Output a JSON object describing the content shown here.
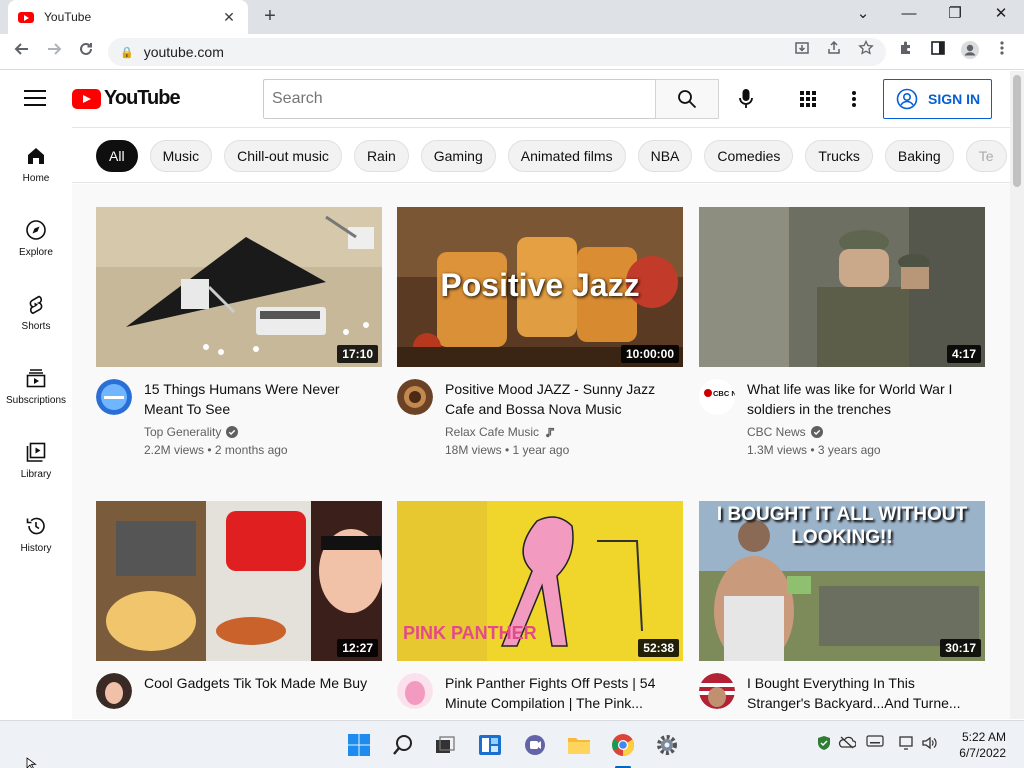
{
  "browser": {
    "tab_title": "YouTube",
    "tab_close": "✕",
    "new_tab": "+",
    "url": "youtube.com",
    "window_controls": [
      "⌄",
      "—",
      "❐",
      "✕"
    ]
  },
  "header": {
    "logo_text": "YouTube",
    "search_placeholder": "Search",
    "sign_in_label": "SIGN IN"
  },
  "sidebar": {
    "items": [
      {
        "label": "Home",
        "icon": "home-icon"
      },
      {
        "label": "Explore",
        "icon": "compass-icon"
      },
      {
        "label": "Shorts",
        "icon": "shorts-icon"
      },
      {
        "label": "Subscriptions",
        "icon": "subscriptions-icon"
      },
      {
        "label": "Library",
        "icon": "library-icon"
      },
      {
        "label": "History",
        "icon": "history-icon"
      }
    ]
  },
  "chips": [
    "All",
    "Music",
    "Chill-out music",
    "Rain",
    "Gaming",
    "Animated films",
    "NBA",
    "Comedies",
    "Trucks",
    "Baking",
    "Te"
  ],
  "videos": [
    {
      "title": "15 Things Humans Were Never Meant To See",
      "channel": "Top Generality",
      "verified": true,
      "stats": "2.2M views • 2 months ago",
      "duration": "17:10"
    },
    {
      "title": "Positive Mood JAZZ - Sunny Jazz Cafe and Bossa Nova Music",
      "channel": "Relax Cafe Music",
      "music_badge": true,
      "stats": "18M views • 1 year ago",
      "duration": "10:00:00",
      "overlay": "Positive Jazz"
    },
    {
      "title": "What life was like for World War I soldiers in the trenches",
      "channel": "CBC News",
      "verified": true,
      "stats": "1.3M views • 3 years ago",
      "duration": "4:17"
    },
    {
      "title": "Cool Gadgets Tik Tok Made Me Buy",
      "channel": "",
      "stats": "",
      "duration": "12:27"
    },
    {
      "title": "Pink Panther Fights Off Pests | 54 Minute Compilation | The Pink...",
      "channel": "",
      "stats": "",
      "duration": "52:38",
      "overlay": "PINK PANTHER"
    },
    {
      "title": "I Bought Everything In This Stranger's Backyard...And Turne...",
      "channel": "",
      "stats": "",
      "duration": "30:17",
      "overlay": "I BOUGHT IT ALL WITHOUT LOOKING!!"
    }
  ],
  "avatar_text": {
    "cbc": "CBC NEWS"
  },
  "taskbar": {
    "time": "5:22 AM",
    "date": "6/7/2022"
  }
}
